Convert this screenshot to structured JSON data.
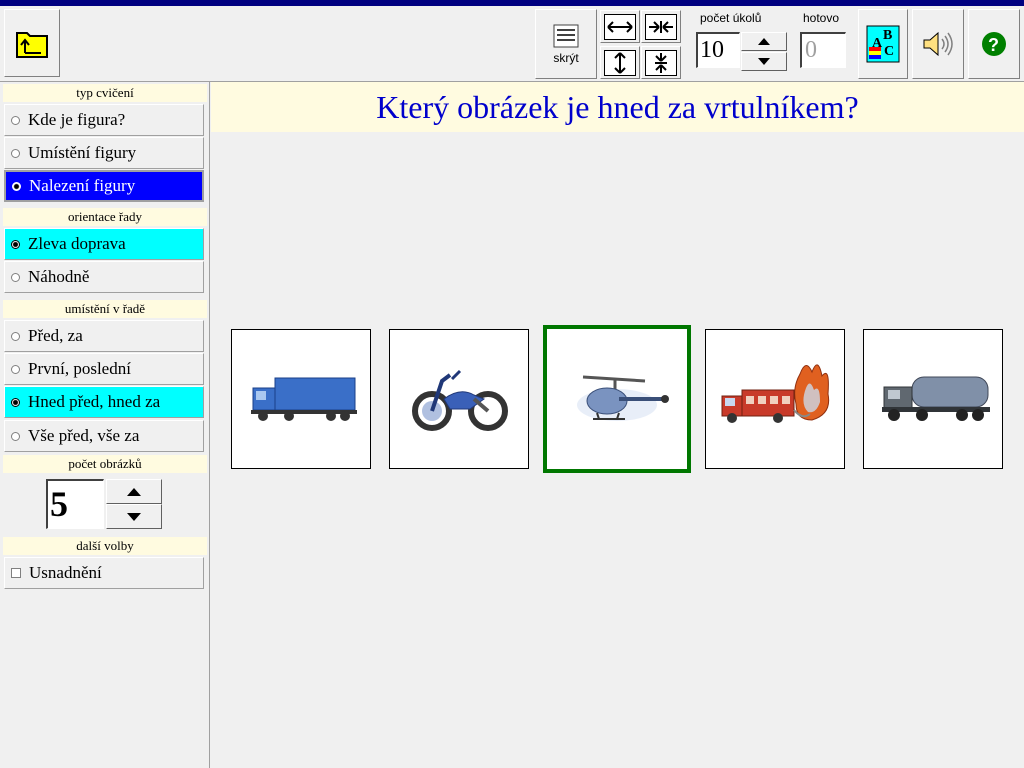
{
  "toolbar": {
    "hide_label": "skrýt",
    "count_label": "počet úkolů",
    "count_value": "10",
    "done_label": "hotovo",
    "done_value": "0"
  },
  "sidebar": {
    "section_type": "typ cvičení",
    "type_options": [
      "Kde je figura?",
      "Umístění figury",
      "Nalezení figury"
    ],
    "section_orientation": "orientace řady",
    "orientation_options": [
      "Zleva doprava",
      "Náhodně"
    ],
    "section_position": "umístění v řadě",
    "position_options": [
      "Před, za",
      "První, poslední",
      "Hned před, hned za",
      "Vše před, vše za"
    ],
    "section_count": "počet obrázků",
    "count_value": "5",
    "section_more": "další volby",
    "more_options": [
      "Usnadnění"
    ]
  },
  "main": {
    "question": "Který obrázek je hned za vrtulníkem?",
    "cards": [
      {
        "name": "truck",
        "icon": "truck-icon"
      },
      {
        "name": "motorcycle",
        "icon": "motorcycle-icon"
      },
      {
        "name": "helicopter",
        "icon": "helicopter-icon",
        "selected": true
      },
      {
        "name": "fire-truck",
        "icon": "fire-truck-icon"
      },
      {
        "name": "tank-truck",
        "icon": "tank-truck-icon"
      }
    ]
  },
  "colors": {
    "title_bar": "#000080",
    "selected_blue": "#0000ff",
    "selected_cyan": "#00ffff",
    "question_text": "#0000cc",
    "header_bg": "#fffbe0",
    "selected_card_border": "#007700"
  }
}
